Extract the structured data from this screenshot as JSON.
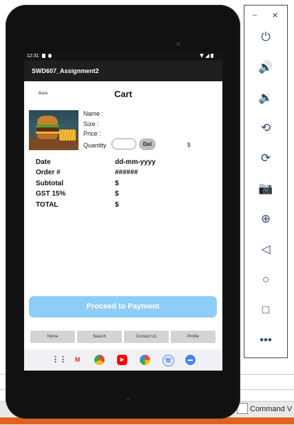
{
  "device": {
    "status_time": "12:31",
    "app_title": "SWD607_Assignment2"
  },
  "cart": {
    "back_label": "Back",
    "title": "Cart",
    "name_label": "Name :",
    "size_label": "Size :",
    "price_label": "Price :",
    "quantity_label": "Quantity",
    "delete_label": "Del",
    "line_total": "$"
  },
  "summary": [
    {
      "label": "Date",
      "value": "dd-mm-yyyy"
    },
    {
      "label": "Order #",
      "value": "######"
    },
    {
      "label": "Subtotal",
      "value": "$"
    },
    {
      "label": "GST 15%",
      "value": "$"
    },
    {
      "label": "TOTAL",
      "value": "$"
    }
  ],
  "pay_button": "Proceed to Payment",
  "nav": [
    "Home",
    "Search",
    "Contact Us",
    "Profile"
  ],
  "dock_icons": [
    "apps-grid-icon",
    "gmail-icon",
    "chrome-icon",
    "youtube-icon",
    "photos-icon",
    "phone-icon",
    "messages-icon"
  ],
  "emulator": {
    "minimize": "–",
    "close": "✕",
    "icons": [
      "power-icon",
      "volume-up-icon",
      "volume-down-icon",
      "rotate-left-icon",
      "rotate-right-icon",
      "camera-icon",
      "zoom-icon",
      "back-icon",
      "home-icon",
      "overview-icon",
      "more-icon"
    ]
  },
  "taskbar": {
    "label": "Command V"
  },
  "colors": {
    "pay_button": "#8ecdf6",
    "app_bar": "#1f1f1f",
    "accent_orange": "#e0621c"
  }
}
